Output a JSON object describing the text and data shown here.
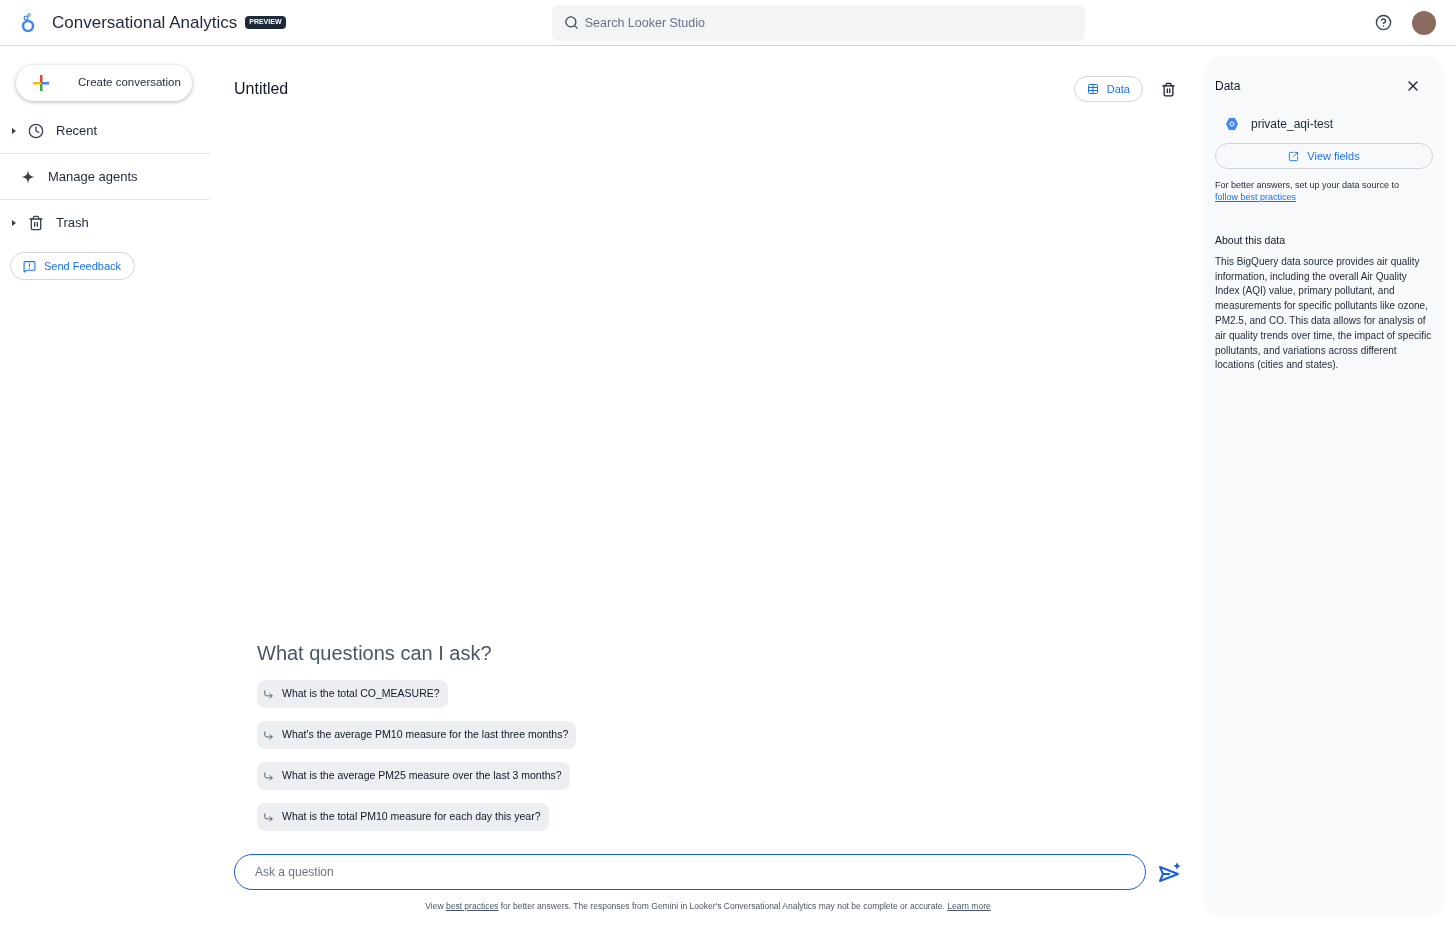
{
  "header": {
    "title": "Conversational Analytics",
    "badge": "PREVIEW",
    "search": {
      "placeholder": "Search Looker Studio"
    }
  },
  "sidebar": {
    "create_button": "Create conversation",
    "items": [
      {
        "label": "Recent",
        "kind": "collapsible",
        "expanded": false
      },
      {
        "label": "Manage agents",
        "kind": "link"
      },
      {
        "label": "Trash",
        "kind": "collapsible",
        "expanded": false
      }
    ],
    "feedback_button": "Send Feedback"
  },
  "main": {
    "title": "Untitled",
    "data_button": {
      "label": "Data",
      "selected": true
    },
    "questions_heading": "What questions can I ask?",
    "questions": [
      "What is the total CO_MEASURE?",
      "What's the average PM10 measure for the last three months?",
      "What is the average PM25 measure over the last 3 months?",
      "What is the total PM10 measure for each day this year?"
    ],
    "input": {
      "placeholder": "Ask a question"
    },
    "disclaimer": [
      {
        "kind": "text",
        "text": "View "
      },
      {
        "kind": "link",
        "text": "best practices"
      },
      {
        "kind": "text",
        "text": " for better answers. The responses from Gemini in Looker's Conversational Analytics may not be complete or accurate. "
      },
      {
        "kind": "link",
        "text": "Learn more"
      }
    ]
  },
  "data_panel": {
    "title": "Data",
    "source": "private_aqi-test",
    "view_fields": "View fields",
    "hint": [
      {
        "kind": "text",
        "text": "For better answers, set up your data source to "
      },
      {
        "kind": "link",
        "text": "follow best practices"
      }
    ],
    "about_heading": "About this data",
    "about_text": "This BigQuery data source provides air quality information, including the overall Air Quality Index (AQI) value, primary pollutant, and measurements for specific pollutants like ozone, PM2.5, and CO. This data allows for analysis of air quality trends over time, the impact of specific pollutants, and variations across different locations (cities and states)."
  }
}
